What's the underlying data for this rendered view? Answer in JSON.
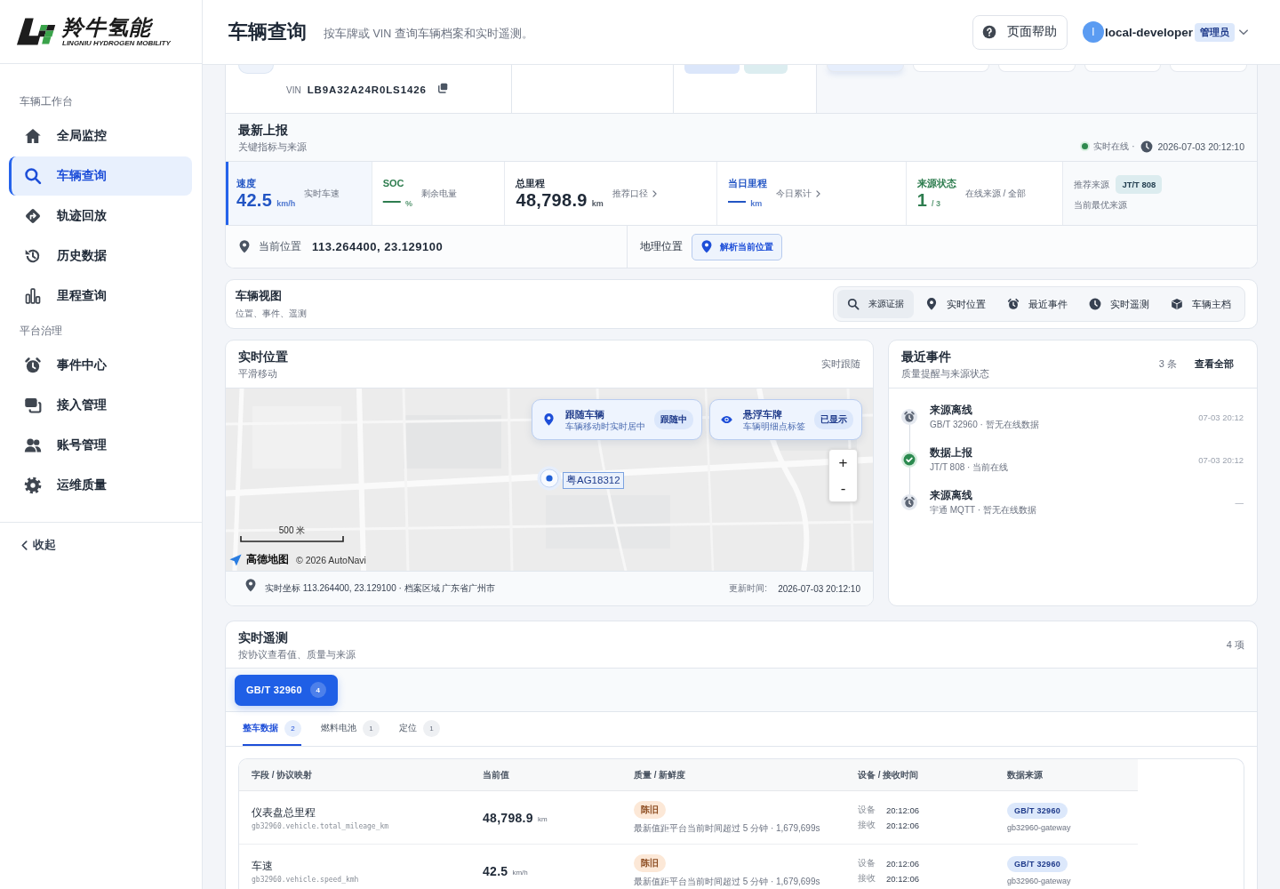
{
  "sidebar": {
    "logo": {
      "name": "羚牛氢能",
      "tagline": "LINGNIU HYDROGEN MOBILITY"
    },
    "sections": [
      {
        "title": "车辆工作台",
        "items": [
          {
            "label": "全局监控",
            "selected": false
          },
          {
            "label": "车辆查询",
            "selected": true
          },
          {
            "label": "轨迹回放",
            "selected": false
          },
          {
            "label": "历史数据",
            "selected": false
          },
          {
            "label": "里程查询",
            "selected": false
          }
        ]
      },
      {
        "title": "平台治理",
        "items": [
          {
            "label": "事件中心",
            "selected": false
          },
          {
            "label": "接入管理",
            "selected": false
          },
          {
            "label": "账号管理",
            "selected": false
          },
          {
            "label": "运维质量",
            "selected": false
          }
        ]
      }
    ],
    "collapse": "收起"
  },
  "header": {
    "title": "车辆查询",
    "subtitle": "按车牌或 VIN 查询车辆档案和实时遥测。",
    "help_button": "页面帮助",
    "user": {
      "avatar": "l",
      "name": "local-developer",
      "role": "管理员"
    }
  },
  "vehicle_card": {
    "vin_label": "VIN",
    "vin": "LB9A32A24R0LS1426",
    "tabs": [
      {
        "selected": true
      },
      {
        "selected": false
      },
      {
        "selected": false
      },
      {
        "selected": false
      },
      {
        "selected": false
      }
    ]
  },
  "latest_report": {
    "title": "最新上报",
    "subtitle": "关键指标与来源",
    "status": "实时在线 ·",
    "time": "2026-07-03 20:12:10",
    "metrics": [
      {
        "kind": "metric",
        "label": "速度",
        "value": "42.5",
        "unit": "km/h",
        "note": "实时车速",
        "link": false,
        "color": "#2255c4",
        "selected": true
      },
      {
        "kind": "metric",
        "label": "SOC",
        "value": "—",
        "unit": "%",
        "note": "剩余电量",
        "link": false,
        "color": "#2e7d4f",
        "selected": false
      },
      {
        "kind": "metric",
        "label": "总里程",
        "value": "48,798.9",
        "unit": "km",
        "note": "推荐口径",
        "link": true,
        "color": "#1f2937",
        "selected": false
      },
      {
        "kind": "metric",
        "label": "当日里程",
        "value": "—",
        "unit": "km",
        "note": "今日累计",
        "link": true,
        "color": "#2255c4",
        "selected": false
      },
      {
        "kind": "metric",
        "label": "来源状态",
        "value": "1",
        "unit": "/ 3",
        "note": "在线来源 / 全部",
        "link": false,
        "color": "#2e7d4f",
        "selected": false
      },
      {
        "kind": "source",
        "label": "推荐来源",
        "badge": "JT/T 808",
        "note": "当前最优来源",
        "selected": false
      }
    ],
    "location": {
      "label": "当前位置",
      "coords": "113.264400, 23.129100",
      "geo_label": "地理位置",
      "resolve_button": "解析当前位置"
    }
  },
  "vehicle_view": {
    "title": "车辆视图",
    "subtitle": "位置、事件、遥测",
    "tabs": [
      {
        "label": "来源证据",
        "selected": true
      },
      {
        "label": "实时位置",
        "selected": false
      },
      {
        "label": "最近事件",
        "selected": false
      },
      {
        "label": "实时遥测",
        "selected": false
      },
      {
        "label": "车辆主档",
        "selected": false
      }
    ]
  },
  "live_location": {
    "title": "实时位置",
    "subtitle": "平滑移动",
    "mode": "实时跟随",
    "map": {
      "controls": [
        {
          "title": "跟随车辆",
          "subtitle": "车辆移动时实时居中",
          "status": "跟随中",
          "on": true
        },
        {
          "title": "悬浮车牌",
          "subtitle": "车辆明细点标签",
          "status": "已显示",
          "on": true
        }
      ],
      "plate": "粤AG18312",
      "zoom_in": "+",
      "zoom_out": "-",
      "scale": "500 米",
      "brand": "高德地图",
      "attribution": "© 2026 AutoNavi"
    },
    "footer": {
      "coords": "实时坐标 113.264400, 23.129100 · 档案区域 广东省广州市",
      "updated_label": "更新时间:",
      "updated": "2026-07-03 20:12:10"
    }
  },
  "recent_events": {
    "title": "最近事件",
    "subtitle": "质量提醒与来源状态",
    "count": "3 条",
    "view_all": "查看全部",
    "items": [
      {
        "kind": "offline",
        "title": "来源离线",
        "detail": "GB/T 32960 · 暂无在线数据",
        "time": "07-03 20:12"
      },
      {
        "kind": "report",
        "title": "数据上报",
        "detail": "JT/T 808 · 当前在线",
        "time": "07-03 20:12"
      },
      {
        "kind": "offline",
        "title": "来源离线",
        "detail": "宇通 MQTT · 暂无在线数据",
        "time": "—"
      }
    ]
  },
  "telemetry": {
    "title": "实时遥测",
    "subtitle": "按协议查看值、质量与来源",
    "count": "4 项",
    "protocols": [
      {
        "label": "GB/T 32960",
        "count": "4",
        "selected": true
      }
    ],
    "groups": [
      {
        "label": "整车数据",
        "count": "2",
        "selected": true
      },
      {
        "label": "燃料电池",
        "count": "1",
        "selected": false
      },
      {
        "label": "定位",
        "count": "1",
        "selected": false
      }
    ],
    "table": {
      "columns": [
        "字段 / 协议映射",
        "当前值",
        "质量 / 新鲜度",
        "设备 / 接收时间",
        "数据来源"
      ],
      "rows": [
        {
          "field": "仪表盘总里程",
          "path": "gb32960.vehicle.total_mileage_km",
          "value": "48,798.9",
          "unit": "km",
          "quality": "陈旧",
          "quality_note": "最新值距平台当前时间超过 5 分钟 · 1,679,699s",
          "device_label": "设备",
          "device_time": "20:12:06",
          "received_label": "接收",
          "received_time": "20:12:06",
          "source": "GB/T 32960",
          "gateway": "gb32960-gateway"
        },
        {
          "field": "车速",
          "path": "gb32960.vehicle.speed_kmh",
          "value": "42.5",
          "unit": "km/h",
          "quality": "陈旧",
          "quality_note": "最新值距平台当前时间超过 5 分钟 · 1,679,699s",
          "device_label": "设备",
          "device_time": "20:12:06",
          "received_label": "接收",
          "received_time": "20:12:06",
          "source": "GB/T 32960",
          "gateway": "gb32960-gateway"
        }
      ]
    }
  }
}
